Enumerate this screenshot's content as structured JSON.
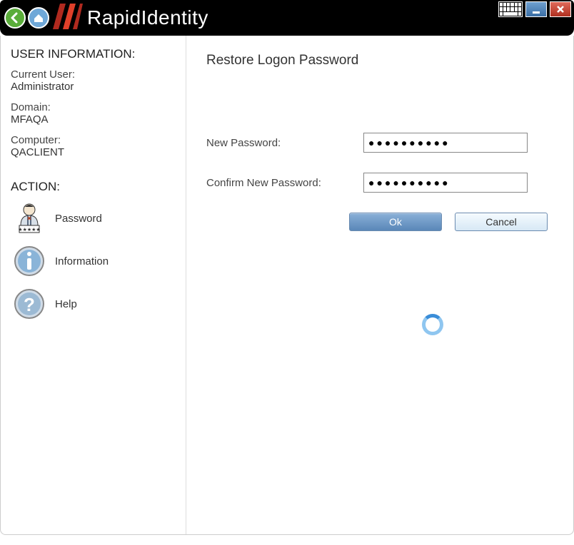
{
  "app": {
    "title": "RapidIdentity"
  },
  "sidebar": {
    "section_user_heading": "USER INFORMATION:",
    "current_user_label": "Current User:",
    "current_user_value": "Administrator",
    "domain_label": "Domain:",
    "domain_value": "MFAQA",
    "computer_label": "Computer:",
    "computer_value": "QACLIENT",
    "section_action_heading": "ACTION:",
    "actions": {
      "password": "Password",
      "information": "Information",
      "help": "Help"
    }
  },
  "main": {
    "title": "Restore Logon Password",
    "new_password_label": "New Password:",
    "confirm_password_label": "Confirm New Password:",
    "new_password_value": "●●●●●●●●●●",
    "confirm_password_value": "●●●●●●●●●●",
    "ok_label": "Ok",
    "cancel_label": "Cancel"
  }
}
